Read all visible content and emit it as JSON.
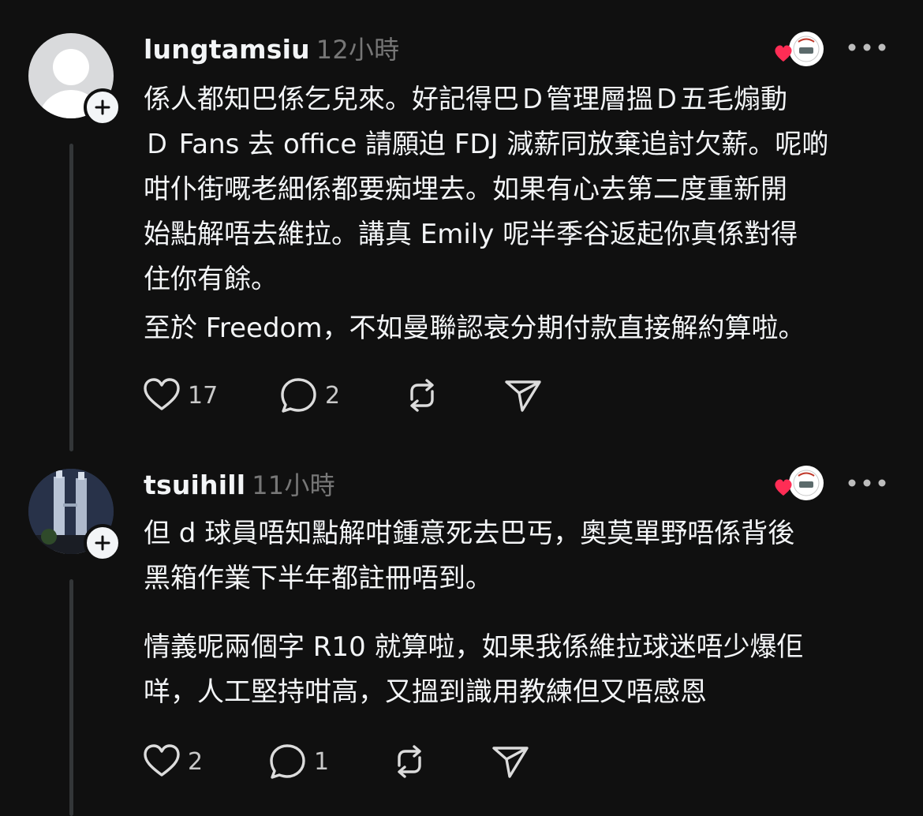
{
  "posts": [
    {
      "username": "lungtamsiu",
      "time": "12小時",
      "paragraphs": [
        "係人都知巴係乞兒來。好記得巴Ｄ管理層搵Ｄ五毛煽動\nＤ Fans 去 office 請願迫 FDJ 減薪同放棄追討欠薪。呢啲\n咁仆街嘅老細係都要痴埋去。如果有心去第二度重新開\n始點解唔去維拉。講真 Emily 呢半季谷返起你真係對得\n住你有餘。",
        "至於 Freedom，不如曼聯認衰分期付款直接解約算啦。"
      ],
      "likes": "17",
      "replies": "2"
    },
    {
      "username": "tsuihill",
      "time": "11小時",
      "paragraphs": [
        "但 d 球員唔知點解咁鍾意死去巴丐，奧莫單野唔係背後\n黑箱作業下半年都註冊唔到。",
        "情義呢兩個字 R10 就算啦，如果我係維拉球迷唔少爆佢\n咩，人工堅持咁高，又搵到識用教練但又唔感恩"
      ],
      "likes": "2",
      "replies": "1"
    }
  ],
  "icons": {
    "like": "heart-icon",
    "reply": "comment-icon",
    "repost": "repost-icon",
    "share": "send-icon",
    "more": "more-horizontal-icon",
    "follow": "plus-icon",
    "reacted": "red-heart-icon"
  },
  "colors": {
    "background": "#101010",
    "text": "#f3f5f7",
    "muted": "#777777",
    "heart": "#ff2d55"
  }
}
